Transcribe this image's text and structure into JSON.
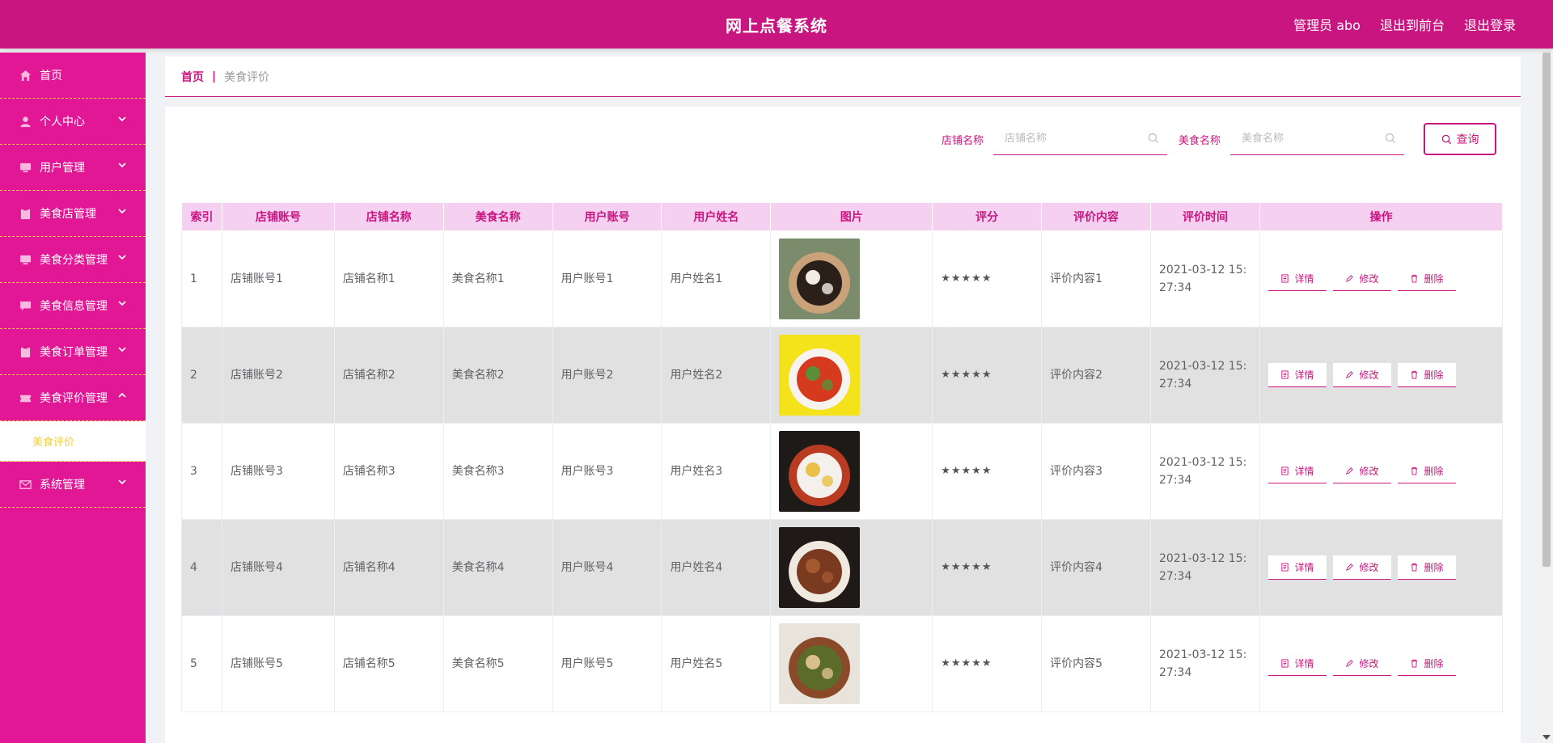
{
  "header": {
    "title": "网上点餐系统",
    "admin": "管理员 abo",
    "to_front": "退出到前台",
    "logout": "退出登录"
  },
  "sidebar": {
    "items": [
      {
        "label": "首页",
        "icon": "home-icon"
      },
      {
        "label": "个人中心",
        "icon": "user-icon"
      },
      {
        "label": "用户管理",
        "icon": "monitor-icon"
      },
      {
        "label": "美食店管理",
        "icon": "clipboard-icon"
      },
      {
        "label": "美食分类管理",
        "icon": "monitor-icon"
      },
      {
        "label": "美食信息管理",
        "icon": "chat-icon"
      },
      {
        "label": "美食订单管理",
        "icon": "clipboard-icon"
      },
      {
        "label": "美食评价管理",
        "icon": "ticket-icon"
      },
      {
        "label": "系统管理",
        "icon": "mail-icon"
      }
    ],
    "submenu_active": "美食评价"
  },
  "breadcrumb": {
    "home": "首页",
    "sep": "|",
    "current": "美食评价"
  },
  "search": {
    "shop_label": "店铺名称",
    "shop_placeholder": "店铺名称",
    "food_label": "美食名称",
    "food_placeholder": "美食名称",
    "query_label": "查询"
  },
  "table": {
    "headers": [
      "索引",
      "店铺账号",
      "店铺名称",
      "美食名称",
      "用户账号",
      "用户姓名",
      "图片",
      "评分",
      "评价内容",
      "评价时间",
      "操作"
    ],
    "ops": {
      "detail": "详情",
      "edit": "修改",
      "delete": "删除"
    },
    "rows": [
      {
        "idx": "1",
        "shop_account": "店铺账号1",
        "shop_name": "店铺名称1",
        "food_name": "美食名称1",
        "user_account": "用户账号1",
        "user_name": "用户姓名1",
        "rating": "★★★★★",
        "content": "评价内容1",
        "time": "2021-03-12 15:27:34"
      },
      {
        "idx": "2",
        "shop_account": "店铺账号2",
        "shop_name": "店铺名称2",
        "food_name": "美食名称2",
        "user_account": "用户账号2",
        "user_name": "用户姓名2",
        "rating": "★★★★★",
        "content": "评价内容2",
        "time": "2021-03-12 15:27:34"
      },
      {
        "idx": "3",
        "shop_account": "店铺账号3",
        "shop_name": "店铺名称3",
        "food_name": "美食名称3",
        "user_account": "用户账号3",
        "user_name": "用户姓名3",
        "rating": "★★★★★",
        "content": "评价内容3",
        "time": "2021-03-12 15:27:34"
      },
      {
        "idx": "4",
        "shop_account": "店铺账号4",
        "shop_name": "店铺名称4",
        "food_name": "美食名称4",
        "user_account": "用户账号4",
        "user_name": "用户姓名4",
        "rating": "★★★★★",
        "content": "评价内容4",
        "time": "2021-03-12 15:27:34"
      },
      {
        "idx": "5",
        "shop_account": "店铺账号5",
        "shop_name": "店铺名称5",
        "food_name": "美食名称5",
        "user_account": "用户账号5",
        "user_name": "用户姓名5",
        "rating": "★★★★★",
        "content": "评价内容5",
        "time": "2021-03-12 15:27:34"
      }
    ]
  },
  "colors": {
    "brand": "#c9157f",
    "sidebar": "#e21795",
    "header_row": "#f5d0f1",
    "accent_yellow": "#f2d03b"
  }
}
